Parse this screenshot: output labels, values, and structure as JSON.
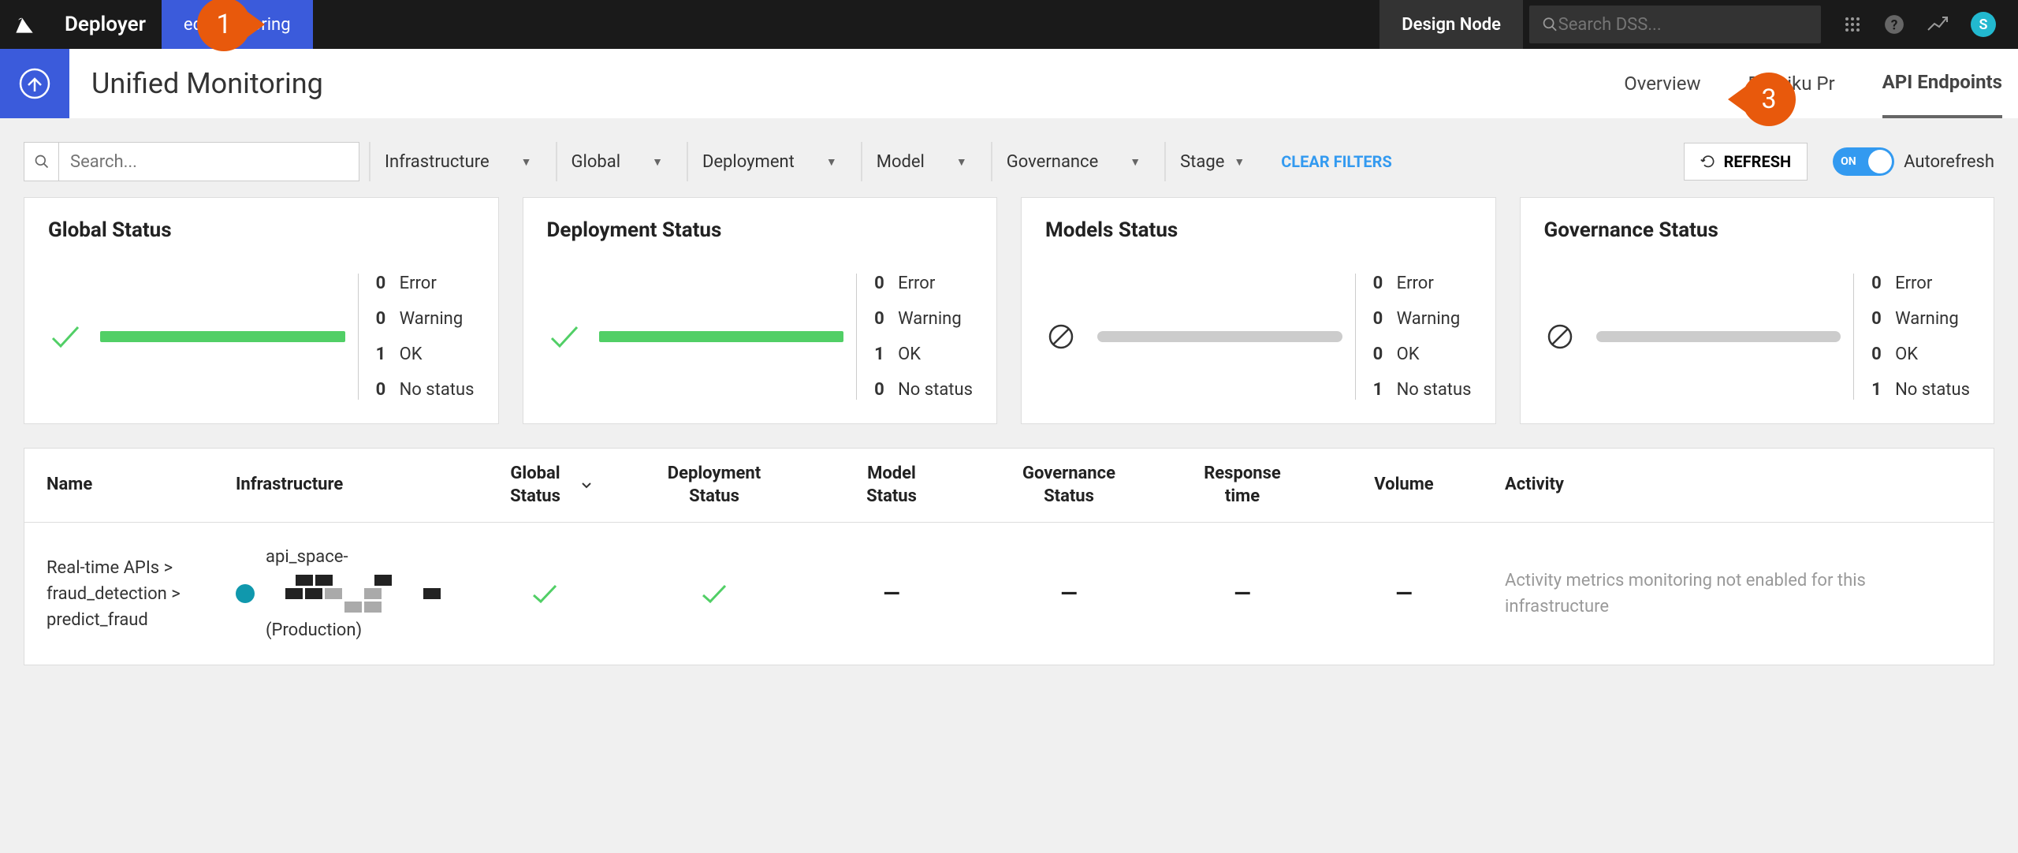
{
  "topnav": {
    "brand": "Deployer",
    "active_tab": "ed Monitoring",
    "design_node": "Design Node",
    "search_placeholder": "Search DSS...",
    "avatar_letter": "S"
  },
  "callouts": {
    "c1": "1",
    "c3": "3"
  },
  "subheader": {
    "title": "Unified Monitoring",
    "tabs": [
      "Overview",
      "Dataiku Pr",
      "API Endpoints"
    ],
    "active_index": 2
  },
  "filters": {
    "search_placeholder": "Search...",
    "dropdowns": [
      "Infrastructure",
      "Global",
      "Deployment",
      "Model",
      "Governance",
      "Stage"
    ],
    "clear": "CLEAR FILTERS",
    "refresh": "REFRESH",
    "autorefresh": "Autorefresh",
    "toggle_on": "ON"
  },
  "status_cards": [
    {
      "title": "Global Status",
      "variant": "ok",
      "legend": [
        [
          "0",
          "Error"
        ],
        [
          "0",
          "Warning"
        ],
        [
          "1",
          "OK"
        ],
        [
          "0",
          "No status"
        ]
      ]
    },
    {
      "title": "Deployment Status",
      "variant": "ok",
      "legend": [
        [
          "0",
          "Error"
        ],
        [
          "0",
          "Warning"
        ],
        [
          "1",
          "OK"
        ],
        [
          "0",
          "No status"
        ]
      ]
    },
    {
      "title": "Models Status",
      "variant": "empty",
      "legend": [
        [
          "0",
          "Error"
        ],
        [
          "0",
          "Warning"
        ],
        [
          "0",
          "OK"
        ],
        [
          "1",
          "No status"
        ]
      ]
    },
    {
      "title": "Governance Status",
      "variant": "empty",
      "legend": [
        [
          "0",
          "Error"
        ],
        [
          "0",
          "Warning"
        ],
        [
          "0",
          "OK"
        ],
        [
          "1",
          "No status"
        ]
      ]
    }
  ],
  "table": {
    "headers": [
      "Name",
      "Infrastructure",
      "Global Status",
      "Deployment Status",
      "Model Status",
      "Governance Status",
      "Response time",
      "Volume",
      "Activity"
    ],
    "row": {
      "name": "Real-time APIs > fraud_detection > predict_fraud",
      "infra_top": "api_space-",
      "infra_bottom": "(Production)",
      "global_status": "ok",
      "deploy_status": "ok",
      "model_status": "—",
      "gov_status": "—",
      "response_time": "—",
      "volume": "—",
      "activity": "Activity metrics monitoring not enabled for this infrastructure"
    }
  }
}
